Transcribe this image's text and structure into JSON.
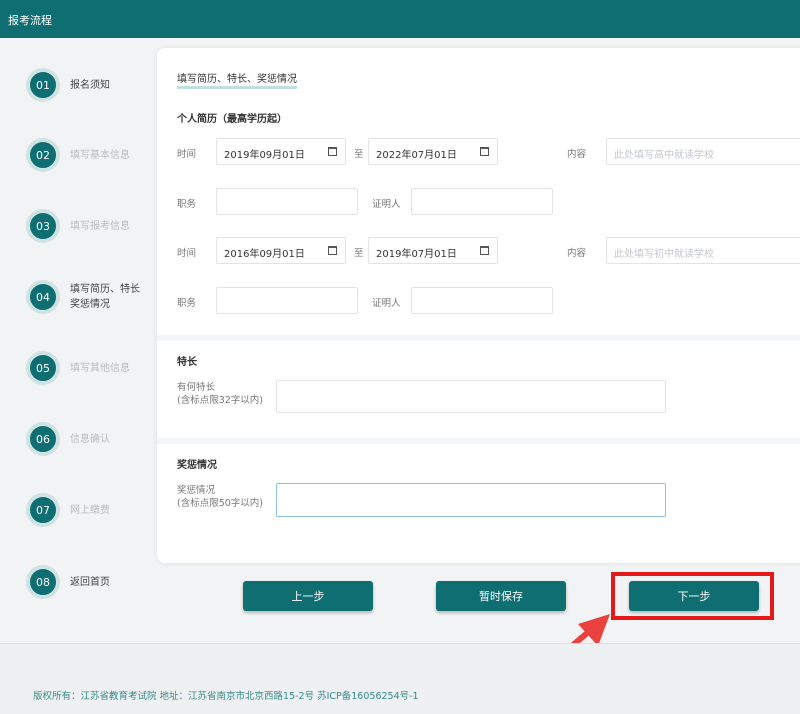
{
  "header": {
    "title": "报考流程"
  },
  "steps": [
    {
      "num": "01",
      "label": "报名须知"
    },
    {
      "num": "02",
      "label": "填写基本信息"
    },
    {
      "num": "03",
      "label": "填写报考信息"
    },
    {
      "num": "04",
      "label": "填写简历、特长 奖惩情况"
    },
    {
      "num": "05",
      "label": "填写其他信息"
    },
    {
      "num": "06",
      "label": "信息确认"
    },
    {
      "num": "07",
      "label": "网上缴费"
    },
    {
      "num": "08",
      "label": "返回首页"
    }
  ],
  "form": {
    "title": "填写简历、特长、奖惩情况",
    "resume": {
      "title": "个人简历（最高学历起）",
      "time_label": "时间",
      "to_label": "至",
      "content_label": "内容",
      "position_label": "职务",
      "witness_label": "证明人",
      "rows": [
        {
          "start": "2019年09月01日",
          "end": "2022年07月01日",
          "content_placeholder": "此处填写高中就读学校",
          "position": "",
          "witness": ""
        },
        {
          "start": "2016年09月01日",
          "end": "2019年07月01日",
          "content_placeholder": "此处填写初中就读学校",
          "position": "",
          "witness": ""
        }
      ]
    },
    "specialty": {
      "title": "特长",
      "label_line1": "有何特长",
      "label_line2": "(含标点限32字以内)"
    },
    "rewards": {
      "title": "奖惩情况",
      "label_line1": "奖惩情况",
      "label_line2": "(含标点限50字以内)"
    }
  },
  "buttons": {
    "prev": "上一步",
    "save": "暂时保存",
    "next": "下一步"
  },
  "footer": {
    "text": "版权所有：江苏省教育考试院 地址：江苏省南京市北京西路15-2号 苏ICP备16056254号-1"
  },
  "colors": {
    "primary": "#0f6e72",
    "highlight": "#e21a1a"
  }
}
